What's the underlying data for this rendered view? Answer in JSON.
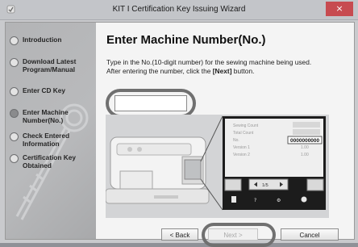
{
  "window": {
    "title": "KIT I Certification Key Issuing Wizard",
    "close_glyph": "×"
  },
  "steps": [
    {
      "label": "Introduction",
      "active": false
    },
    {
      "label": "Download Latest Program/Manual",
      "active": false
    },
    {
      "label": "Enter CD Key",
      "active": false
    },
    {
      "label": "Enter Machine Number(No.)",
      "active": true
    },
    {
      "label": "Check Entered Information",
      "active": false
    },
    {
      "label": "Certification Key Obtained",
      "active": false
    }
  ],
  "content": {
    "heading": "Enter Machine Number(No.)",
    "instruction_1": "Type in the No.(10-digit number) for the sewing machine being used.",
    "instruction_2_prefix": "After entering the number, click the ",
    "instruction_2_bold": "[Next]",
    "instruction_2_suffix": " button."
  },
  "machine_number": {
    "value": "",
    "placeholder": ""
  },
  "illustration": {
    "screen_rows": [
      {
        "label": "Sewing Count",
        "value": ""
      },
      {
        "label": "Total Count",
        "value": ""
      },
      {
        "label": "No.",
        "value": "0000000000"
      },
      {
        "label": "Version 1",
        "value": "1.00"
      },
      {
        "label": "Version 2",
        "value": "1.00"
      }
    ],
    "page_indicator": "1/5"
  },
  "buttons": {
    "back": "< Back",
    "next": "Next >",
    "cancel": "Cancel"
  },
  "colors": {
    "highlight_ring": "#707070",
    "title_close_bg": "#c74b50"
  }
}
